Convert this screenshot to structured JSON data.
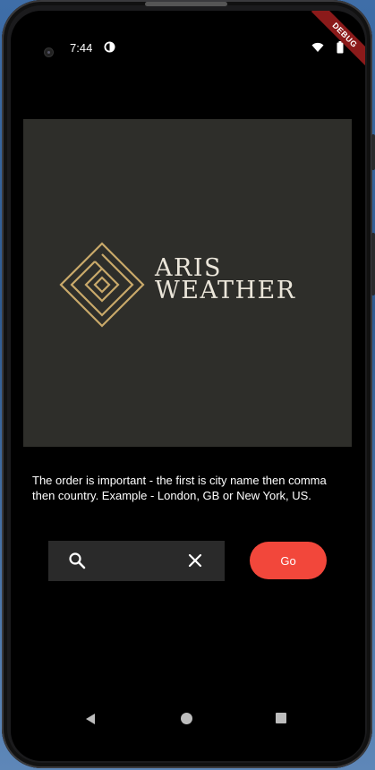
{
  "status_bar": {
    "time": "7:44",
    "debug_label": "DEBUG"
  },
  "logo": {
    "line1": "ARIS",
    "line2": "WEATHER"
  },
  "instructions": "The order is important - the first is city name then comma then country. Example - London, GB or New York, US.",
  "search": {
    "value": "",
    "placeholder": ""
  },
  "go_button": {
    "label": "Go"
  },
  "colors": {
    "accent": "#f2473b",
    "banner_bg": "#2e2e2a",
    "logo_gold": "#c9a96a",
    "search_bg": "#2a2a2a"
  },
  "icons": {
    "search": "search-icon",
    "clear": "close-icon",
    "back": "back-triangle-icon",
    "home": "home-circle-icon",
    "recent": "recent-square-icon"
  }
}
